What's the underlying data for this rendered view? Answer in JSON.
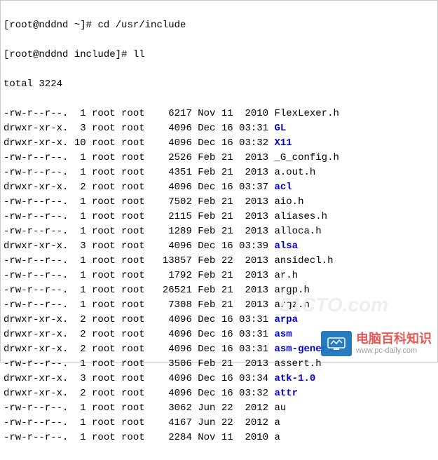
{
  "prompt1": {
    "user_host": "[root@nddnd ~]#",
    "command": "cd /usr/include"
  },
  "prompt2": {
    "user_host": "[root@nddnd include]#",
    "command": "ll"
  },
  "total_line": "total 3224",
  "listing": [
    {
      "perm": "-rw-r--r--.",
      "links": " 1",
      "owner": "root",
      "group": "root",
      "size": "   6217",
      "month": "Nov",
      "day": "11",
      "time": " 2010",
      "name": "FlexLexer.h",
      "dir": false
    },
    {
      "perm": "drwxr-xr-x.",
      "links": " 3",
      "owner": "root",
      "group": "root",
      "size": "   4096",
      "month": "Dec",
      "day": "16",
      "time": "03:31",
      "name": "GL",
      "dir": true
    },
    {
      "perm": "drwxr-xr-x.",
      "links": "10",
      "owner": "root",
      "group": "root",
      "size": "   4096",
      "month": "Dec",
      "day": "16",
      "time": "03:32",
      "name": "X11",
      "dir": true
    },
    {
      "perm": "-rw-r--r--.",
      "links": " 1",
      "owner": "root",
      "group": "root",
      "size": "   2526",
      "month": "Feb",
      "day": "21",
      "time": " 2013",
      "name": "_G_config.h",
      "dir": false
    },
    {
      "perm": "-rw-r--r--.",
      "links": " 1",
      "owner": "root",
      "group": "root",
      "size": "   4351",
      "month": "Feb",
      "day": "21",
      "time": " 2013",
      "name": "a.out.h",
      "dir": false
    },
    {
      "perm": "drwxr-xr-x.",
      "links": " 2",
      "owner": "root",
      "group": "root",
      "size": "   4096",
      "month": "Dec",
      "day": "16",
      "time": "03:37",
      "name": "acl",
      "dir": true
    },
    {
      "perm": "-rw-r--r--.",
      "links": " 1",
      "owner": "root",
      "group": "root",
      "size": "   7502",
      "month": "Feb",
      "day": "21",
      "time": " 2013",
      "name": "aio.h",
      "dir": false
    },
    {
      "perm": "-rw-r--r--.",
      "links": " 1",
      "owner": "root",
      "group": "root",
      "size": "   2115",
      "month": "Feb",
      "day": "21",
      "time": " 2013",
      "name": "aliases.h",
      "dir": false
    },
    {
      "perm": "-rw-r--r--.",
      "links": " 1",
      "owner": "root",
      "group": "root",
      "size": "   1289",
      "month": "Feb",
      "day": "21",
      "time": " 2013",
      "name": "alloca.h",
      "dir": false
    },
    {
      "perm": "drwxr-xr-x.",
      "links": " 3",
      "owner": "root",
      "group": "root",
      "size": "   4096",
      "month": "Dec",
      "day": "16",
      "time": "03:39",
      "name": "alsa",
      "dir": true
    },
    {
      "perm": "-rw-r--r--.",
      "links": " 1",
      "owner": "root",
      "group": "root",
      "size": "  13857",
      "month": "Feb",
      "day": "22",
      "time": " 2013",
      "name": "ansidecl.h",
      "dir": false
    },
    {
      "perm": "-rw-r--r--.",
      "links": " 1",
      "owner": "root",
      "group": "root",
      "size": "   1792",
      "month": "Feb",
      "day": "21",
      "time": " 2013",
      "name": "ar.h",
      "dir": false
    },
    {
      "perm": "-rw-r--r--.",
      "links": " 1",
      "owner": "root",
      "group": "root",
      "size": "  26521",
      "month": "Feb",
      "day": "21",
      "time": " 2013",
      "name": "argp.h",
      "dir": false
    },
    {
      "perm": "-rw-r--r--.",
      "links": " 1",
      "owner": "root",
      "group": "root",
      "size": "   7308",
      "month": "Feb",
      "day": "21",
      "time": " 2013",
      "name": "argz.h",
      "dir": false
    },
    {
      "perm": "drwxr-xr-x.",
      "links": " 2",
      "owner": "root",
      "group": "root",
      "size": "   4096",
      "month": "Dec",
      "day": "16",
      "time": "03:31",
      "name": "arpa",
      "dir": true
    },
    {
      "perm": "drwxr-xr-x.",
      "links": " 2",
      "owner": "root",
      "group": "root",
      "size": "   4096",
      "month": "Dec",
      "day": "16",
      "time": "03:31",
      "name": "asm",
      "dir": true
    },
    {
      "perm": "drwxr-xr-x.",
      "links": " 2",
      "owner": "root",
      "group": "root",
      "size": "   4096",
      "month": "Dec",
      "day": "16",
      "time": "03:31",
      "name": "asm-generic",
      "dir": true
    },
    {
      "perm": "-rw-r--r--.",
      "links": " 1",
      "owner": "root",
      "group": "root",
      "size": "   3506",
      "month": "Feb",
      "day": "21",
      "time": " 2013",
      "name": "assert.h",
      "dir": false
    },
    {
      "perm": "drwxr-xr-x.",
      "links": " 3",
      "owner": "root",
      "group": "root",
      "size": "   4096",
      "month": "Dec",
      "day": "16",
      "time": "03:34",
      "name": "atk-1.0",
      "dir": true
    },
    {
      "perm": "drwxr-xr-x.",
      "links": " 2",
      "owner": "root",
      "group": "root",
      "size": "   4096",
      "month": "Dec",
      "day": "16",
      "time": "03:32",
      "name": "attr",
      "dir": true
    },
    {
      "perm": "-rw-r--r--.",
      "links": " 1",
      "owner": "root",
      "group": "root",
      "size": "   3062",
      "month": "Jun",
      "day": "22",
      "time": " 2012",
      "name": "au",
      "dir": false
    },
    {
      "perm": "-rw-r--r--.",
      "links": " 1",
      "owner": "root",
      "group": "root",
      "size": "   4167",
      "month": "Jun",
      "day": "22",
      "time": " 2012",
      "name": "a",
      "dir": false
    },
    {
      "perm": "-rw-r--r--.",
      "links": " 1",
      "owner": "root",
      "group": "root",
      "size": "   2284",
      "month": "Nov",
      "day": "11",
      "time": " 2010",
      "name": "a",
      "dir": false
    }
  ],
  "watermark": {
    "faint": "51CTO.com",
    "cn": "电脑百科知识",
    "url": "www.pc-daily.com"
  }
}
